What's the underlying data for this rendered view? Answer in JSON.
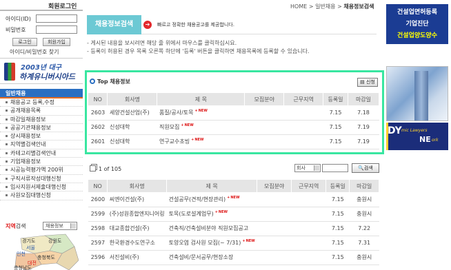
{
  "login": {
    "title": "회원로그인",
    "id_label": "아이디(ID)",
    "pw_label": "비밀번호",
    "login_button": "로그인",
    "join_button": "회원가입",
    "find_link": "아이디/비밀번호 찾기"
  },
  "univ_banner": {
    "year": "2003년 대구",
    "name": "하계유니버시아드"
  },
  "menu": {
    "header": "일반채용",
    "items": [
      "채용공고 등록,수정",
      "공개채용목록",
      "마감일채용정보",
      "공공기관채용정보",
      "상시채용정보",
      "지역별검색안내",
      "카테고리별검색안내",
      "기업채용정보",
      "시공능력평가액 200위",
      "구직서류작성대행신청",
      "입사지원서제출대행신청",
      "사원모집대행신청"
    ]
  },
  "region": {
    "label_prefix": "지역",
    "label_suffix": "검색",
    "select_value": "채용정보"
  },
  "map_labels": [
    "경기도",
    "강원도",
    "서울",
    "인천",
    "충청북도",
    "대전",
    "충청남도"
  ],
  "breadcrumb": {
    "home": "HOME",
    "sep": ">",
    "parent": "일반채용",
    "current": "채용정보검색"
  },
  "page_header": {
    "title": "채용정보검색",
    "arrow": "➔",
    "desc": "빠르고 정확한 채용공고를 제공합니다."
  },
  "guide": [
    "- 게시된 내용을 보시려면 해당 줄 위에서 마우스를 클릭하십시요.",
    "- 등록이 허용된 경우 목록 오른쪽 하단에 '등록' 버튼을 클릭하면 채용목록에 등록할 수 있습니다."
  ],
  "top_section": {
    "title": "Top 채용정보",
    "apply_button": "신청",
    "columns": [
      "NO",
      "회사명",
      "제 목",
      "모집분야",
      "근무지역",
      "등록일",
      "마감일"
    ],
    "rows": [
      {
        "no": "2603",
        "company": "세양건설산업(주)",
        "title": "품질/공사/토목",
        "new": "NEW",
        "field": "",
        "area": "",
        "reg": "7.15",
        "due": "7.18"
      },
      {
        "no": "2602",
        "company": "신성대학",
        "title": "직원모집",
        "new": "NEW",
        "field": "",
        "area": "",
        "reg": "7.15",
        "due": "7.19"
      },
      {
        "no": "2601",
        "company": "신성대학",
        "title": "연구교수초빙",
        "new": "NEW",
        "field": "",
        "area": "",
        "reg": "7.15",
        "due": "7.19"
      }
    ]
  },
  "list_section": {
    "page_info": "1 of 105",
    "search_select": "회사",
    "search_placeholder": "",
    "search_button": "검색",
    "columns": [
      "NO",
      "회사명",
      "제 목",
      "모집분야",
      "근무지역",
      "등록일",
      "마감일"
    ],
    "rows": [
      {
        "no": "2600",
        "company": "씨엔이건설(주)",
        "title": "건설공무(견적/현장관리)",
        "new": "NEW",
        "field": "",
        "area": "",
        "reg": "7.15",
        "due": "충원시"
      },
      {
        "no": "2599",
        "company": "(주)성원종합엔지니어링",
        "title": "토목(도로설계업무)",
        "new": "NEW",
        "field": "",
        "area": "",
        "reg": "7.15",
        "due": "충원시"
      },
      {
        "no": "2598",
        "company": "대교종합건설(주)",
        "title": "건축직/건축설비분야 직원모집공고",
        "new": "",
        "field": "",
        "area": "",
        "reg": "7.15",
        "due": "7.22"
      },
      {
        "no": "2597",
        "company": "한국환경수도연구소",
        "title": "토양오염 검사원 모집(~ 7/31)",
        "new": "NEW",
        "field": "",
        "area": "",
        "reg": "7.15",
        "due": "7.31"
      },
      {
        "no": "2596",
        "company": "서진설비(주)",
        "title": "건축설비/문서공무/현장소장",
        "new": "",
        "field": "",
        "area": "",
        "reg": "7.15",
        "due": "충원시"
      }
    ]
  },
  "ads": {
    "ad1": [
      "건설업면허등록",
      "기업진단",
      "건설업양도양수"
    ],
    "ad3": {
      "big": "DY",
      "small": "mic Lawyers",
      "ne": "NE",
      "ork": "ork"
    }
  }
}
